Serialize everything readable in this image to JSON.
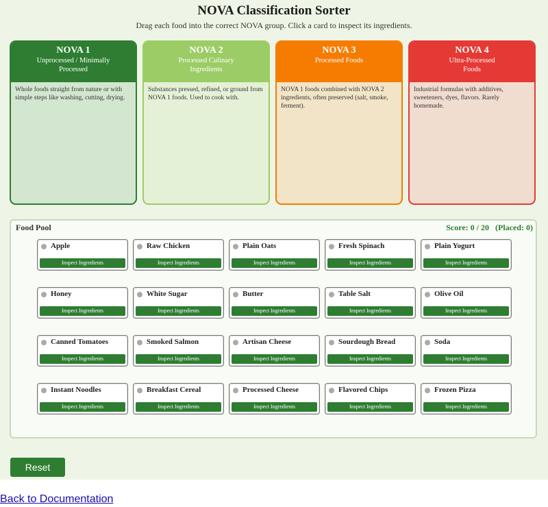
{
  "page": {
    "title": "NOVA Classification Sorter",
    "subtitle": "Drag each food into the correct NOVA group. Click a card to inspect its ingredients."
  },
  "bins": [
    {
      "name": "NOVA 1",
      "subtitle": "Unprocessed / Minimally Processed",
      "description": "Whole foods straight from nature or with simple steps like washing, cutting, drying.",
      "header_color": "#2e7d32",
      "border_color": "#2e7d32",
      "body_color": "#d3e6d0"
    },
    {
      "name": "NOVA 2",
      "subtitle": "Processed Culinary Ingredients",
      "description": "Substances pressed, refined, or ground from NOVA 1 foods. Used to cook with.",
      "header_color": "#9ccc65",
      "border_color": "#9ccc65",
      "body_color": "#e5f1d6"
    },
    {
      "name": "NOVA 3",
      "subtitle": "Processed Foods",
      "description": "NOVA 1 foods combined with NOVA 2 ingredients, often preserved (salt, smoke, ferment).",
      "header_color": "#f57c00",
      "border_color": "#f57c00",
      "body_color": "#f2e4c6"
    },
    {
      "name": "NOVA 4",
      "subtitle": "Ultra-Processed Foods",
      "description": "Industrial formulas with additives, sweeteners, dyes, flavors. Rarely homemade.",
      "header_color": "#e53935",
      "border_color": "#e53935",
      "body_color": "#f1dcd0"
    }
  ],
  "pool": {
    "title": "Food Pool",
    "score_text": "Score: 0 / 20",
    "placed_text": "(Placed: 0)",
    "inspect_label": "Inspect Ingredients",
    "foods": [
      "Apple",
      "Raw Chicken",
      "Plain Oats",
      "Fresh Spinach",
      "Plain Yogurt",
      "Honey",
      "White Sugar",
      "Butter",
      "Table Salt",
      "Olive Oil",
      "Canned Tomatoes",
      "Smoked Salmon",
      "Artisan Cheese",
      "Sourdough Bread",
      "Soda",
      "Instant Noodles",
      "Breakfast Cereal",
      "Processed Cheese",
      "Flavored Chips",
      "Frozen Pizza"
    ]
  },
  "controls": {
    "reset_label": "Reset"
  },
  "footer": {
    "back_link": "Back to Documentation"
  }
}
